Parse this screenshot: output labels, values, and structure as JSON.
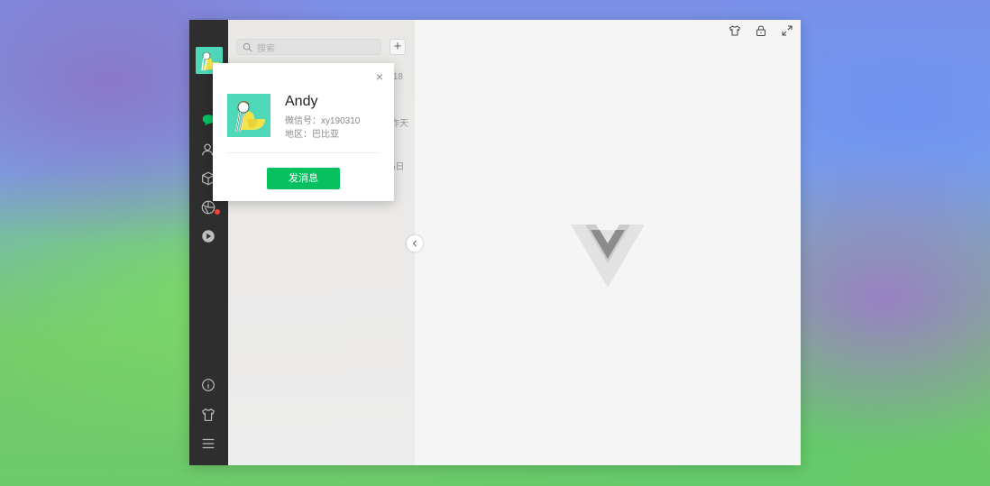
{
  "list": {
    "search_placeholder": "搜索",
    "add_label": "+",
    "times": [
      ":18",
      "作天",
      "5日"
    ]
  },
  "profile_card": {
    "close_label": "×",
    "name": "Andy",
    "wechat_id_line": "微信号：xy190310",
    "region_line": "地区：巴比亚",
    "send_message_label": "发消息"
  },
  "colors": {
    "accent": "#07c160",
    "sidebar_bg": "#2e2e2e",
    "avatar_bg": "#4fd8b8",
    "notification_dot": "#f44336"
  },
  "icons": {
    "sidebar_top": [
      "chat-icon",
      "contacts-icon",
      "box-icon",
      "moments-icon",
      "video-channel-icon"
    ],
    "sidebar_bottom": [
      "info-icon",
      "shirt-icon",
      "menu-icon"
    ],
    "window_controls": [
      "theme-shirt-icon",
      "lock-icon",
      "fullscreen-icon"
    ]
  }
}
